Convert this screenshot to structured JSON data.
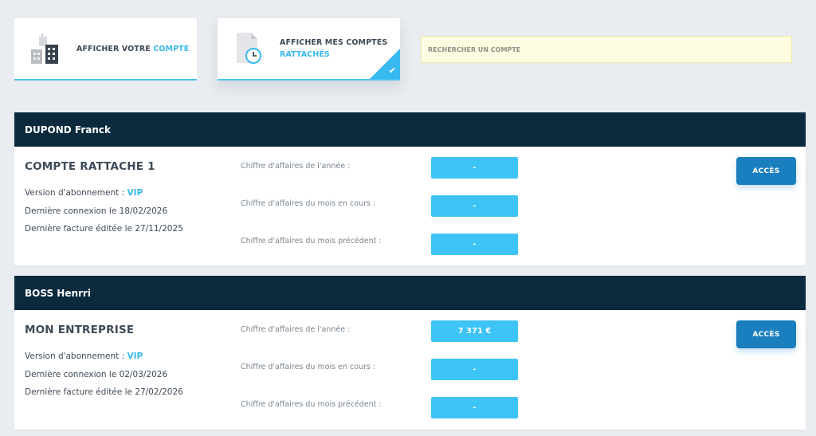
{
  "tiles": [
    {
      "label_main": "AFFICHER VOTRE ",
      "label_accent": "COMPTE",
      "icon": "buildings-icon"
    },
    {
      "label_main": "AFFICHER MES COMPTES",
      "label_accent": "RATTACHÉS",
      "icon": "document-clock-icon",
      "selected": true
    }
  ],
  "search": {
    "placeholder": "RECHERCHER UN COMPTE",
    "value": ""
  },
  "metric_labels": {
    "year": "Chiffre d'affaires de l'année :",
    "current_month": "Chiffre d'affaires du mois en cours :",
    "previous_month": "Chiffre d'affaires du mois précédent :"
  },
  "accounts": [
    {
      "owner": "DUPOND Franck",
      "name": "COMPTE RATTACHE 1",
      "subscription_label": "Version d'abonnement : ",
      "subscription": "VIP",
      "last_login": "Dernière connexion le 18/02/2026",
      "last_invoice": "Dernière facture éditée le 27/11/2025",
      "ca_year": "-",
      "ca_current_month": "-",
      "ca_previous_month": "-",
      "access_label": "ACCÈS"
    },
    {
      "owner": "BOSS Henrri",
      "name": "MON ENTREPRISE",
      "subscription_label": "Version d'abonnement : ",
      "subscription": "VIP",
      "last_login": "Dernière connexion le 02/03/2026",
      "last_invoice": "Dernière facture éditée le 27/02/2026",
      "ca_year": "7 371 €",
      "ca_current_month": "-",
      "ca_previous_month": "-",
      "access_label": "ACCÈS"
    }
  ],
  "colors": {
    "accent": "#37b9ef",
    "header_bg": "#0c2a3e",
    "button": "#1a7fbf",
    "search_bg": "#fffde1"
  }
}
